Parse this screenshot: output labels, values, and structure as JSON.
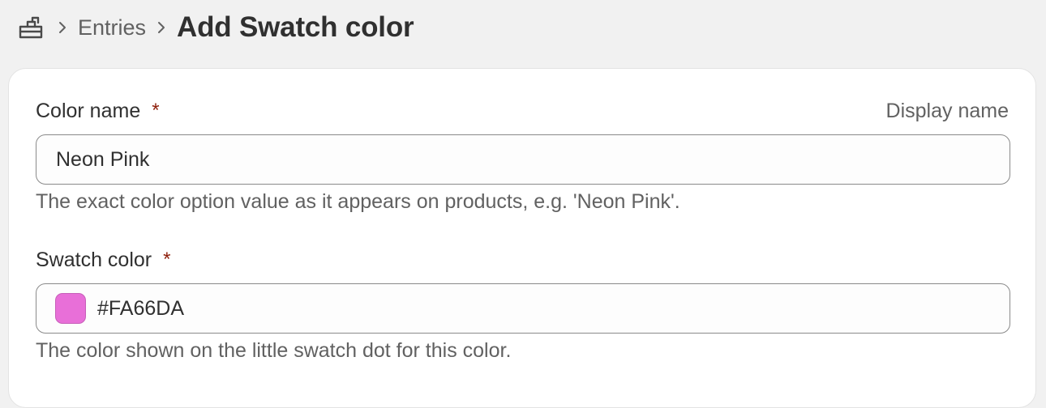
{
  "breadcrumb": {
    "home_icon": "metaobject-icon",
    "separator_icon": "chevron-right-icon",
    "parent": "Entries",
    "title": "Add Swatch color"
  },
  "form": {
    "color_name": {
      "label": "Color name",
      "required_marker": "*",
      "aux_label": "Display name",
      "value": "Neon Pink",
      "help": "The exact color option value as it appears on products, e.g. 'Neon Pink'."
    },
    "swatch_color": {
      "label": "Swatch color",
      "required_marker": "*",
      "value": "#FA66DA",
      "swatch_hex": "#E86FD8",
      "help": "The color shown on the little swatch dot for this color."
    }
  },
  "colors": {
    "background": "#F1F1F1",
    "card": "#FFFFFF",
    "required": "#8E1F0B",
    "muted_text": "#616161",
    "text": "#303030"
  }
}
